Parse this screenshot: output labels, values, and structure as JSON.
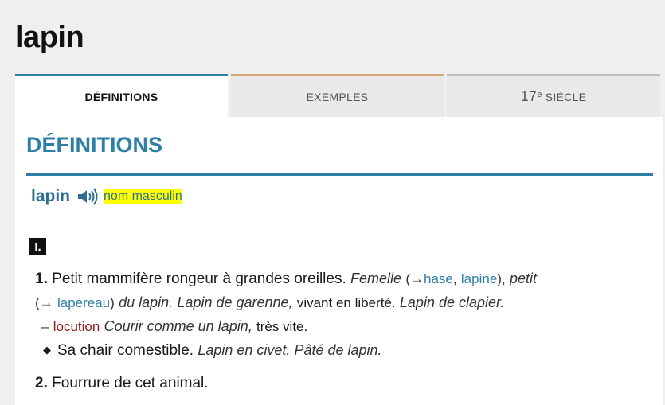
{
  "entry": {
    "title": "lapin"
  },
  "tabs": [
    {
      "label": "DÉFINITIONS"
    },
    {
      "label": "EXEMPLES"
    },
    {
      "label_num": "17",
      "label_sup": "e",
      "label_rest": "SIÈCLE"
    }
  ],
  "definitions": {
    "heading": "DÉFINITIONS",
    "headword": "lapin",
    "pos": "nom masculin",
    "section_roman": "I.",
    "items": {
      "one": {
        "number": "1.",
        "text": "Petit mammifère rongeur à grandes oreilles.",
        "feminine_label": "Femelle",
        "open_paren": "(→",
        "link_hase": "hase",
        "comma1": ",",
        "link_lapine": "lapine",
        "close_paren_comma": "),",
        "young_label": "petit",
        "open_paren2": "(→",
        "link_lapereau": "lapereau",
        "close_paren2": ")",
        "young_text": "du lapin.",
        "example1": "Lapin de garenne,",
        "example1_rest": "vivant en liberté.",
        "example2": "Lapin de clapier.",
        "dash": "–",
        "locution_label": "locution",
        "locution_text": "Courir comme un lapin,",
        "locution_def": "très vite.",
        "bullet": "◆",
        "sub_text": "Sa chair comestible.",
        "sub_examples": "Lapin en civet. Pâté de lapin."
      },
      "two": {
        "number": "2.",
        "text": "Fourrure de cet animal."
      }
    }
  },
  "colors": {
    "accent": "#2e7fa8",
    "highlight": "#ffff00",
    "locution": "#8b1a1a"
  },
  "icons": {
    "speaker": "speaker-icon"
  }
}
